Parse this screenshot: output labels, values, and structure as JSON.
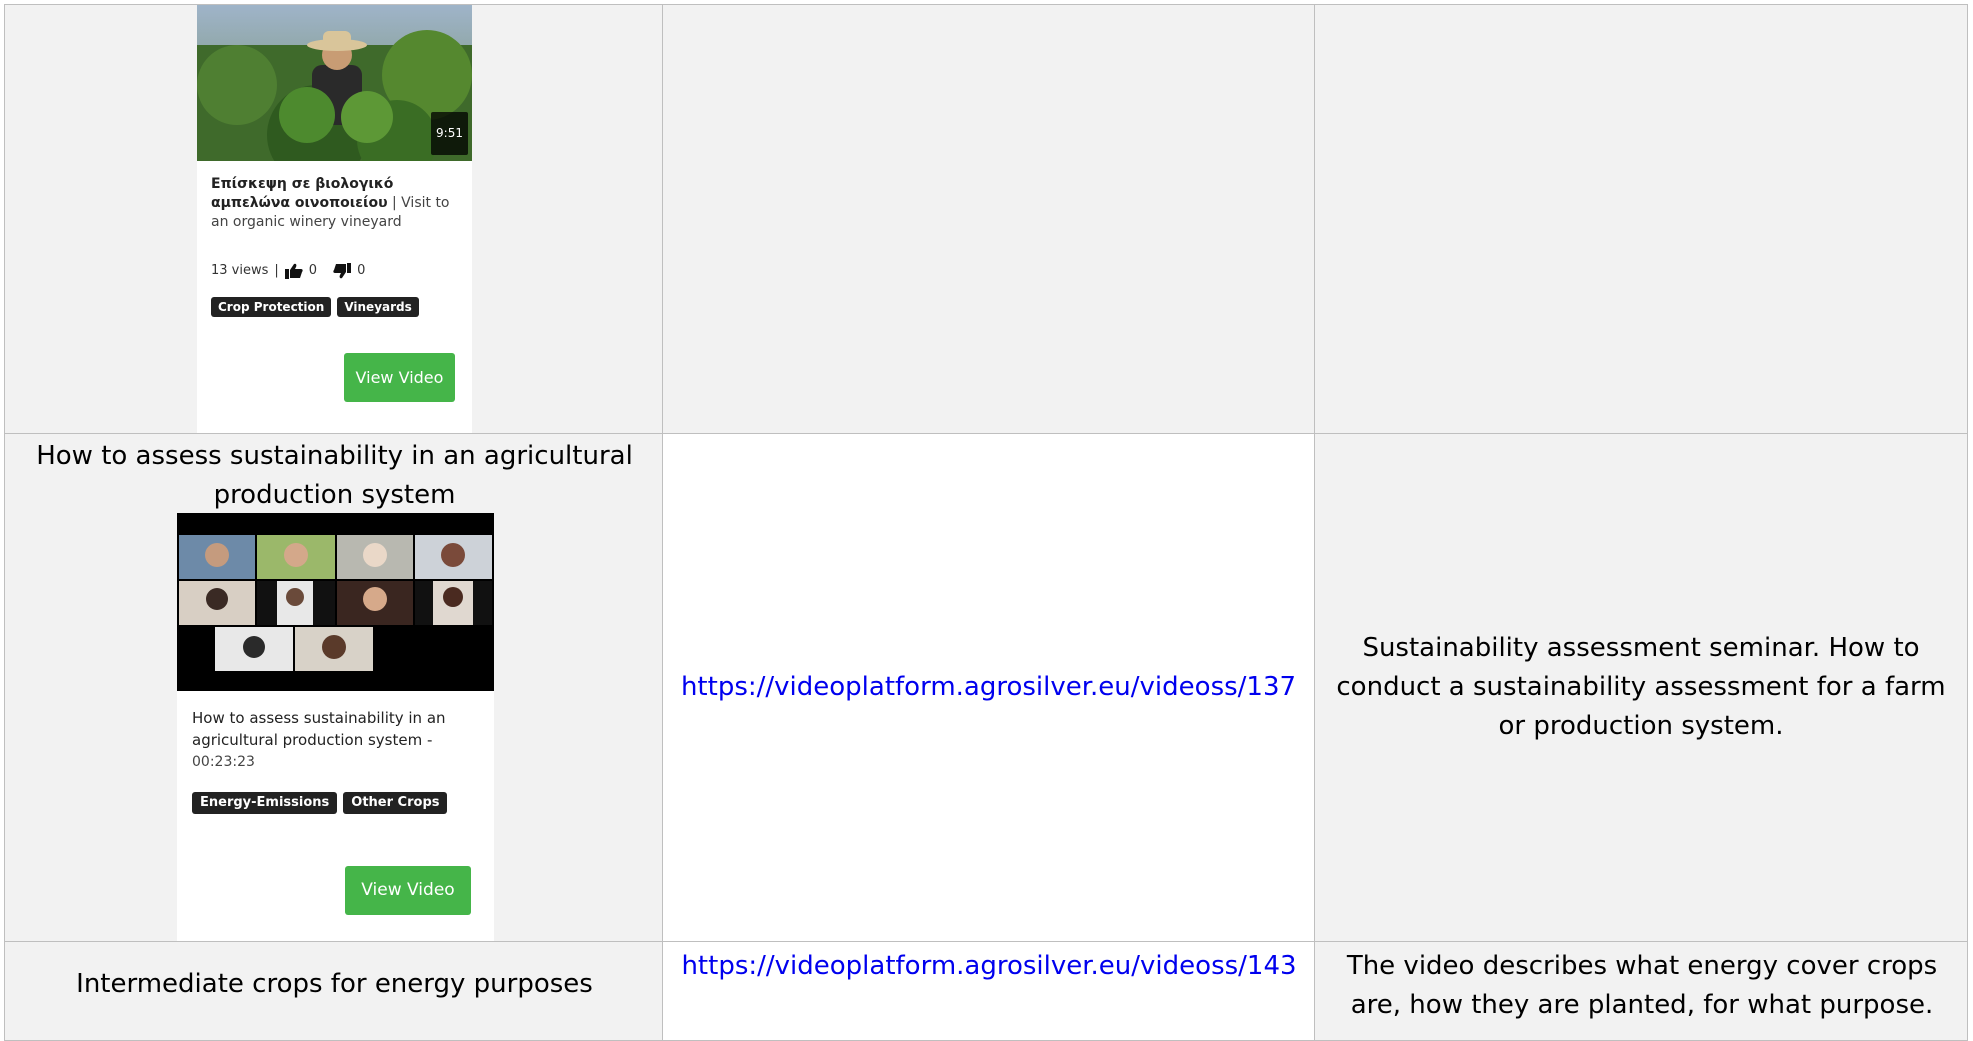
{
  "rows": [
    {
      "title": "",
      "url": "",
      "description": "",
      "card": {
        "duration": "9:51",
        "title_bold": "Επίσκεψη σε βιολογικό αμπελώνα οινοποιείου",
        "title_rest": " | Visit to an organic winery vineyard",
        "views": "13 views",
        "likes": "0",
        "dislikes": "0",
        "tags": [
          "Crop Protection",
          "Vineyards"
        ],
        "button": "View Video"
      }
    },
    {
      "title": "How to assess sustainability in an agricultural production system",
      "url": "https://videoplatform.agrosilver.eu/videoss/137",
      "description": "Sustainability assessment seminar. How to conduct a sustainability assessment for a farm or production system.",
      "card": {
        "title_bold": "How to assess sustainability in an agricultural production system -",
        "time": "00:23:23",
        "tags": [
          "Energy-Emissions",
          "Other Crops"
        ],
        "button": "View Video"
      }
    },
    {
      "title": "Intermediate crops for energy purposes",
      "url": "https://videoplatform.agrosilver.eu/videoss/143",
      "description": "The video describes what energy cover crops are, how they are planted, for what purpose."
    }
  ],
  "colors": {
    "cell_shade": "#f2f2f2",
    "border": "#bfbfbf",
    "link": "#0000ee",
    "button_green": "#45b549",
    "tag_dark": "#222222"
  }
}
